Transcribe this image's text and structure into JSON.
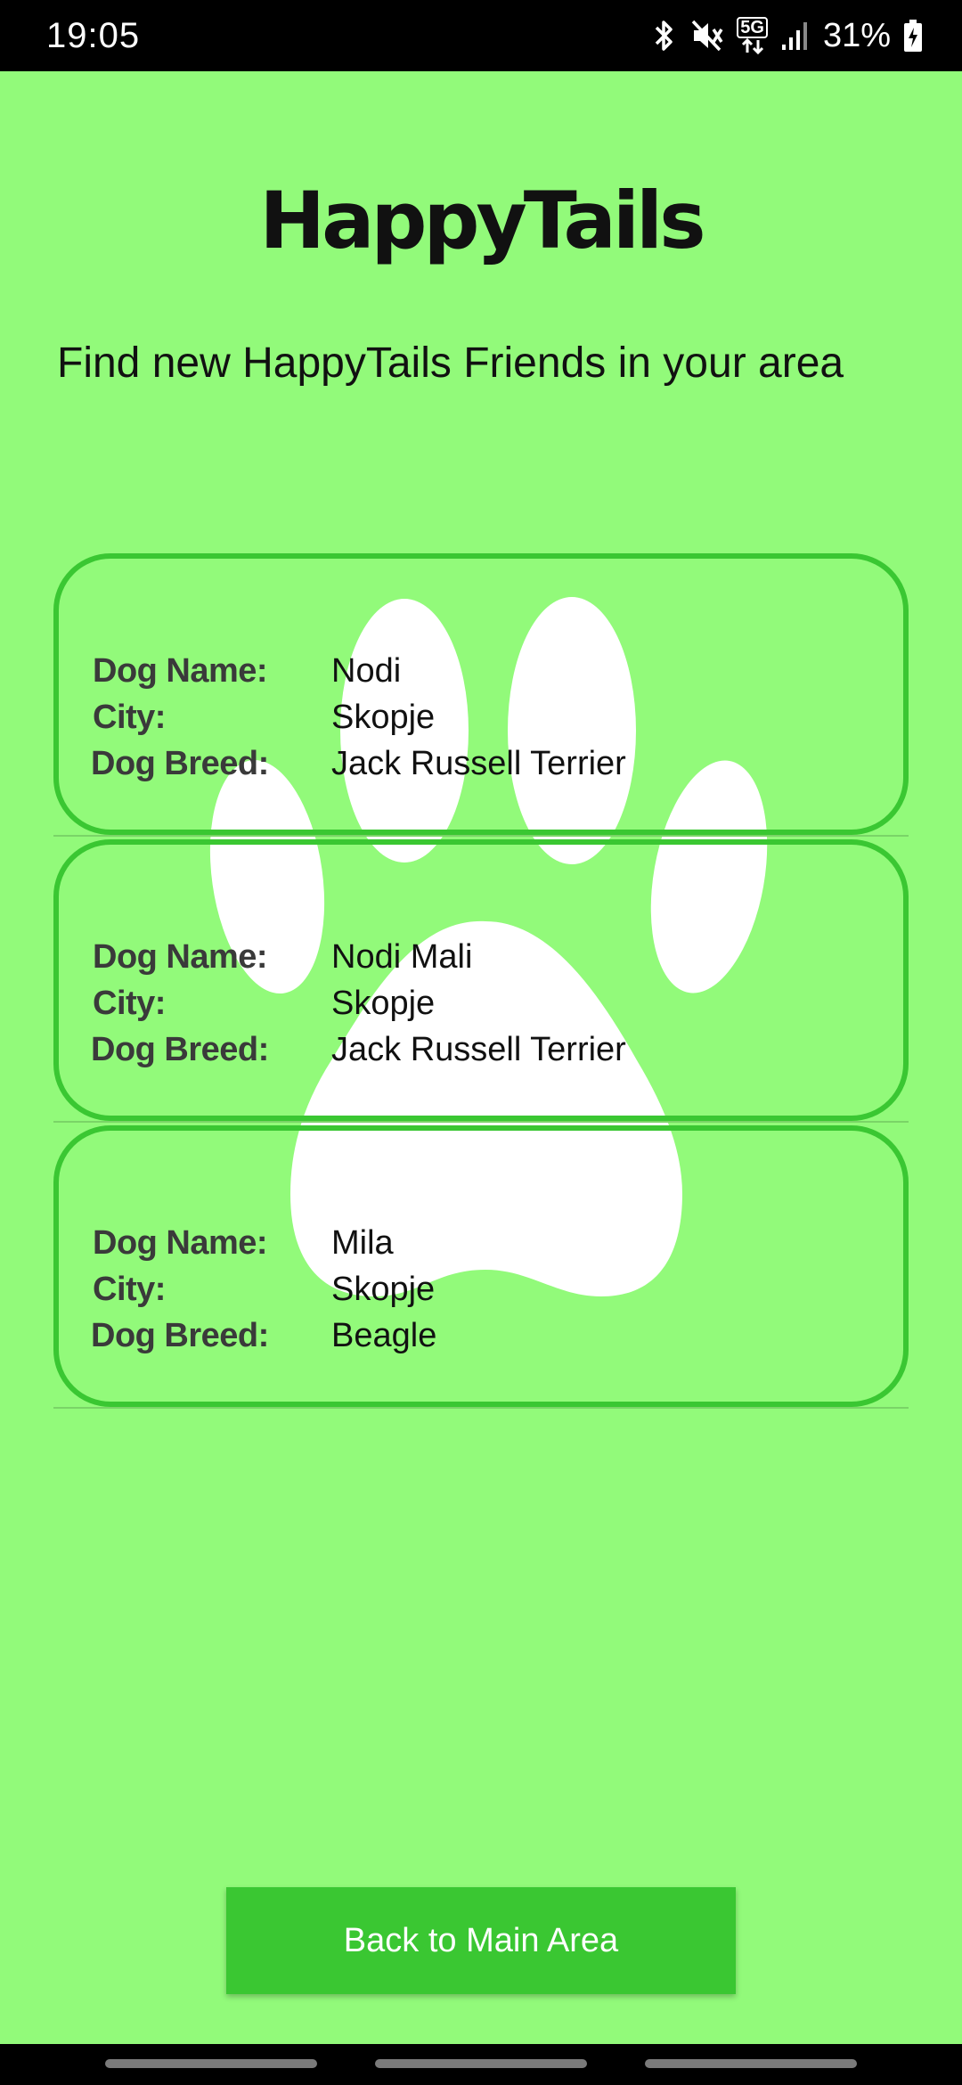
{
  "status_bar": {
    "time": "19:05",
    "network_label": "5G",
    "battery": "31%",
    "icons": [
      "bluetooth-icon",
      "mute-icon",
      "5g-icon",
      "signal-icon",
      "battery-icon"
    ]
  },
  "app": {
    "logo": "HappyTails",
    "subtitle": "Find new HappyTails Friends in your area",
    "colors": {
      "background": "#92fa7a",
      "accent": "#3ac732",
      "paw": "#ffffff"
    }
  },
  "labels": {
    "dog_name": "Dog Name:",
    "city": "City:",
    "dog_breed": "Dog Breed:"
  },
  "dogs": [
    {
      "name": "Nodi",
      "city": "Skopje",
      "breed": "Jack Russell Terrier"
    },
    {
      "name": "Nodi Mali",
      "city": "Skopje",
      "breed": "Jack Russell Terrier"
    },
    {
      "name": "Mila",
      "city": "Skopje",
      "breed": "Beagle"
    }
  ],
  "back_button": {
    "label": "Back to Main Area"
  }
}
